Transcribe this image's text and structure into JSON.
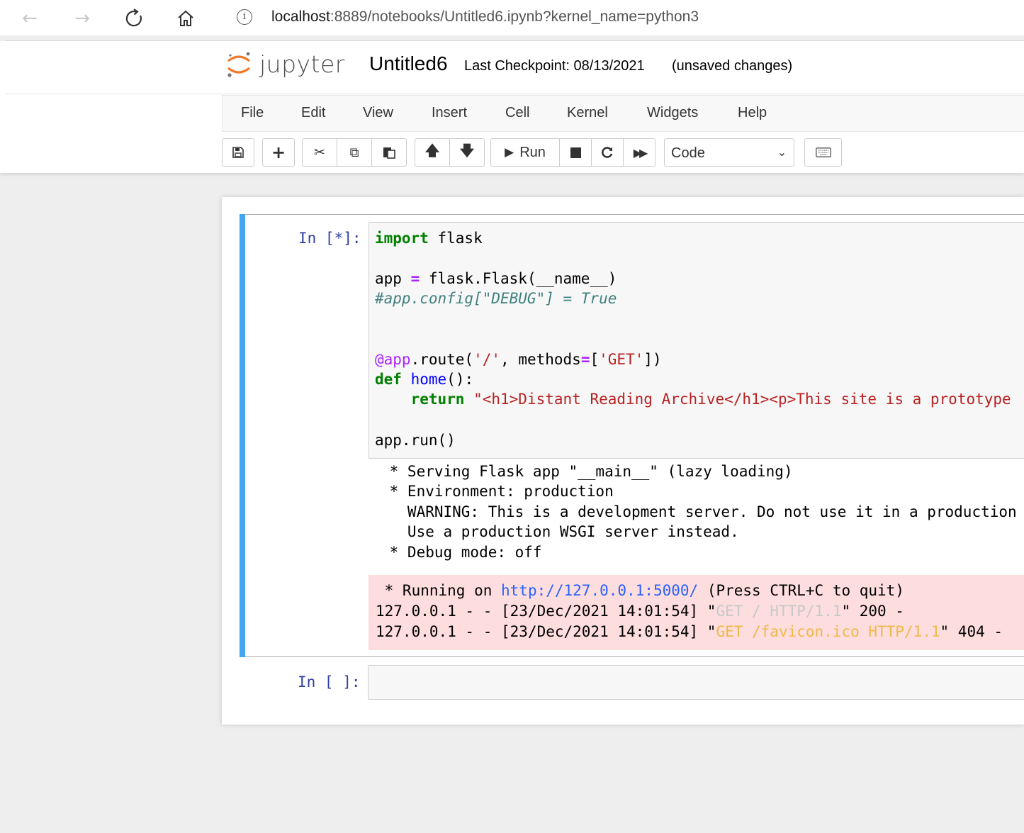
{
  "browser": {
    "url_host": "localhost",
    "url_rest": ":8889/notebooks/Untitled6.ipynb?kernel_name=python3",
    "icons": [
      "back-arrow",
      "forward-arrow",
      "reload",
      "home",
      "info"
    ]
  },
  "header": {
    "logo_text": "jupyter",
    "notebook_title": "Untitled6",
    "checkpoint": "Last Checkpoint: 08/13/2021",
    "status": "(unsaved changes)"
  },
  "menu": [
    "File",
    "Edit",
    "View",
    "Insert",
    "Cell",
    "Kernel",
    "Widgets",
    "Help"
  ],
  "toolbar": {
    "run_label": "Run",
    "cell_type": "Code"
  },
  "cell1": {
    "prompt": "In [*]:",
    "code": {
      "line1_kw": "import",
      "line1_rest": " flask",
      "line3_a": "app ",
      "line3_op": "=",
      "line3_b": " flask.Flask(__name__)",
      "line4_comment": "#app.config[\"DEBUG\"] = True",
      "line7_dec": "@app",
      "line7_a": ".route(",
      "line7_s1": "'/'",
      "line7_b": ", methods",
      "line7_op": "=",
      "line7_c": "[",
      "line7_s2": "'GET'",
      "line7_d": "])",
      "line8_kw": "def",
      "line8_fn": "home",
      "line8_rest": "():",
      "line9_kw": "return",
      "line9_str": "\"<h1>Distant Reading Archive</h1><p>This site is a prototype",
      "line11": "app.run()"
    },
    "stdout": [
      " * Serving Flask app \"__main__\" (lazy loading)",
      " * Environment: production",
      "   WARNING: This is a development server. Do not use it in a production",
      "   Use a production WSGI server instead.",
      " * Debug mode: off"
    ],
    "stderr": {
      "l1_a": " * Running on ",
      "l1_link": "http://127.0.0.1:5000/",
      "l1_b": " (Press CTRL+C to quit)",
      "l2_a": "127.0.0.1 - - [23/Dec/2021 14:01:54] \"",
      "l2_req": "GET / HTTP/1.1",
      "l2_b": "\" 200 -",
      "l3_a": "127.0.0.1 - - [23/Dec/2021 14:01:54] \"",
      "l3_req": "GET /favicon.ico HTTP/1.1",
      "l3_b": "\" 404 -"
    }
  },
  "cell2": {
    "prompt": "In [ ]:"
  }
}
